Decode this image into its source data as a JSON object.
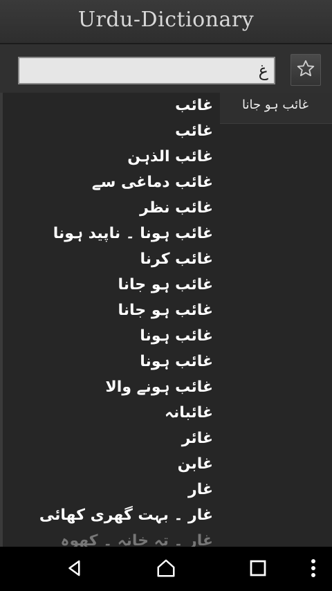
{
  "app": {
    "title": "Urdu-Dictionary"
  },
  "search": {
    "value": "غ",
    "favorite_icon": "star-outline-icon"
  },
  "selected": {
    "word": "غائب ہو جانا"
  },
  "results": [
    "غائب",
    "غائب",
    "غائب الذہن",
    "غائب دماغی سے",
    "غائب نظر",
    "غائب ہونا ۔ ناپید ہونا",
    "غائب کرنا",
    "غائب ہو جانا",
    "غائب ہو جانا",
    "غائب ہونا",
    "غائب ہونا",
    "غائب ہونے والا",
    "غائبانہ",
    "غائر",
    "غابن",
    "غار",
    "غار ۔ بہت گھری کھائی",
    "غار ۔ تہ خانہ ۔ کھوہ"
  ],
  "navbar": {
    "back": "back-icon",
    "home": "home-icon",
    "recents": "recents-icon",
    "menu": "overflow-menu-icon"
  }
}
